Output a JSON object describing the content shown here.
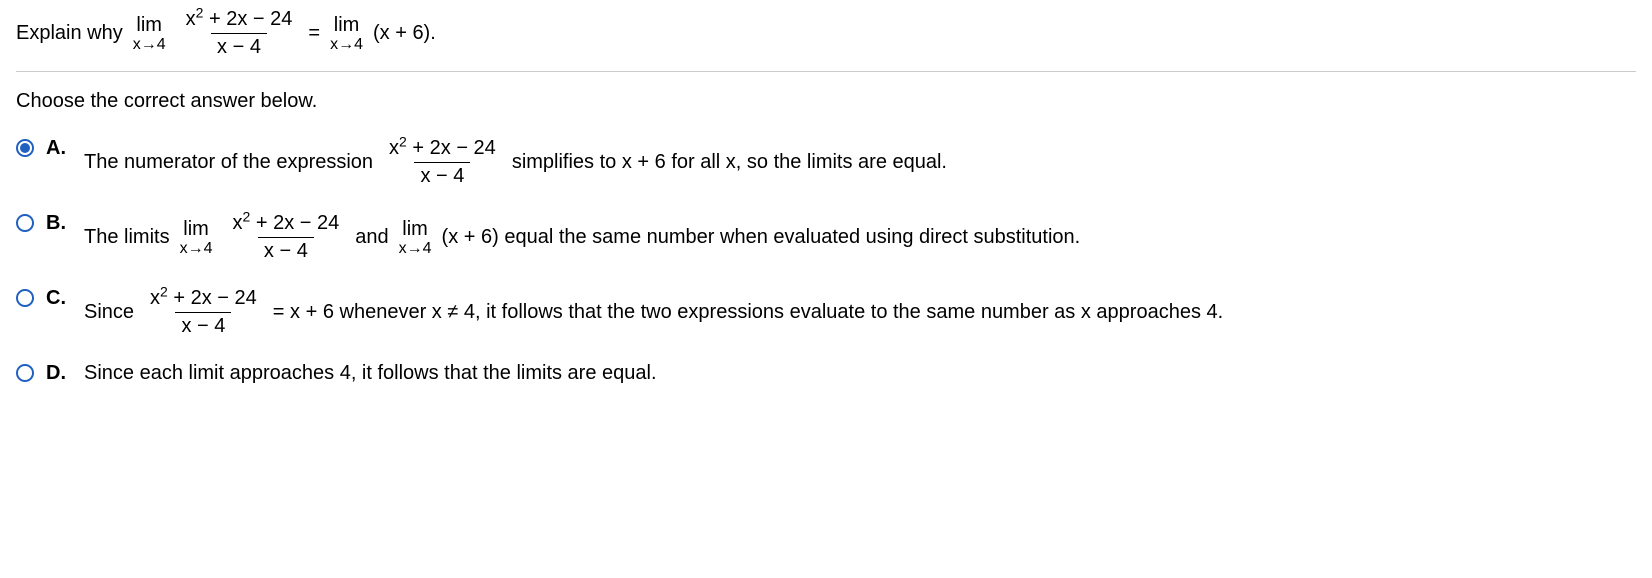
{
  "prompt": {
    "pre": "Explain why",
    "lim_top": "lim",
    "lim1_bot": "x→4",
    "frac_num": "x",
    "frac_num_rest": " + 2x − 24",
    "frac_den": "x − 4",
    "eq": "=",
    "lim2_bot": "x→4",
    "rhs": "(x + 6)."
  },
  "instruction": "Choose the correct answer below.",
  "choices": {
    "A": {
      "label": "A.",
      "t1": "The numerator of the expression",
      "t2": "simplifies to x + 6 for all x, so the limits are equal."
    },
    "B": {
      "label": "B.",
      "t1": "The limits",
      "t2": "and",
      "t3": "(x + 6) equal the same number when evaluated using direct substitution."
    },
    "C": {
      "label": "C.",
      "t1": "Since",
      "t2": "= x + 6 whenever x ≠ 4, it follows that the two expressions evaluate to the same number as x approaches 4."
    },
    "D": {
      "label": "D.",
      "t1": "Since each limit approaches 4, it follows that the limits are equal."
    }
  },
  "selected": "A",
  "math": {
    "sup2": "2"
  }
}
